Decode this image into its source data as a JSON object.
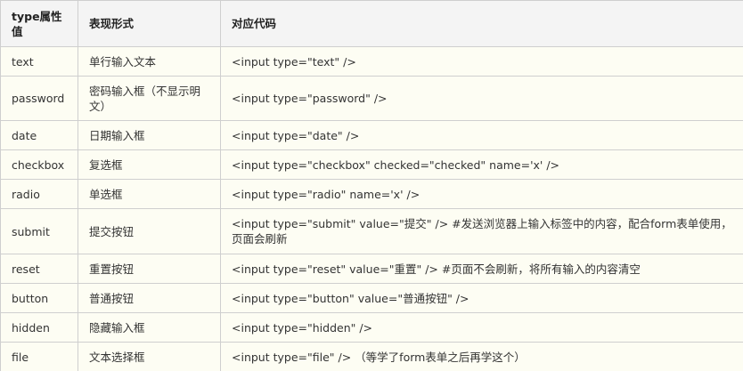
{
  "table": {
    "headers": [
      "type属性值",
      "表现形式",
      "对应代码"
    ],
    "rows": [
      {
        "type": "text",
        "form": "单行输入文本",
        "code": "<input type=\"text\" />"
      },
      {
        "type": "password",
        "form": "密码输入框（不显示明文）",
        "code": "<input type=\"password\"  />"
      },
      {
        "type": "date",
        "form": "日期输入框",
        "code": "<input type=\"date\" />"
      },
      {
        "type": "checkbox",
        "form": "复选框",
        "code": "<input type=\"checkbox\" checked=\"checked\" name='x' />"
      },
      {
        "type": "radio",
        "form": "单选框",
        "code": "<input type=\"radio\" name='x' />"
      },
      {
        "type": "submit",
        "form": "提交按钮",
        "code": "<input type=\"submit\" value=\"提交\" /> #发送浏览器上输入标签中的内容，配合form表单使用，页面会刷新"
      },
      {
        "type": "reset",
        "form": "重置按钮",
        "code": "<input type=\"reset\" value=\"重置\"  />  #页面不会刷新，将所有输入的内容清空"
      },
      {
        "type": "button",
        "form": "普通按钮",
        "code": "<input type=\"button\" value=\"普通按钮\"  />"
      },
      {
        "type": "hidden",
        "form": "隐藏输入框",
        "code": "<input type=\"hidden\"  />"
      },
      {
        "type": "file",
        "form": "文本选择框",
        "code": "<input type=\"file\"  /> （等学了form表单之后再学这个）"
      }
    ]
  }
}
